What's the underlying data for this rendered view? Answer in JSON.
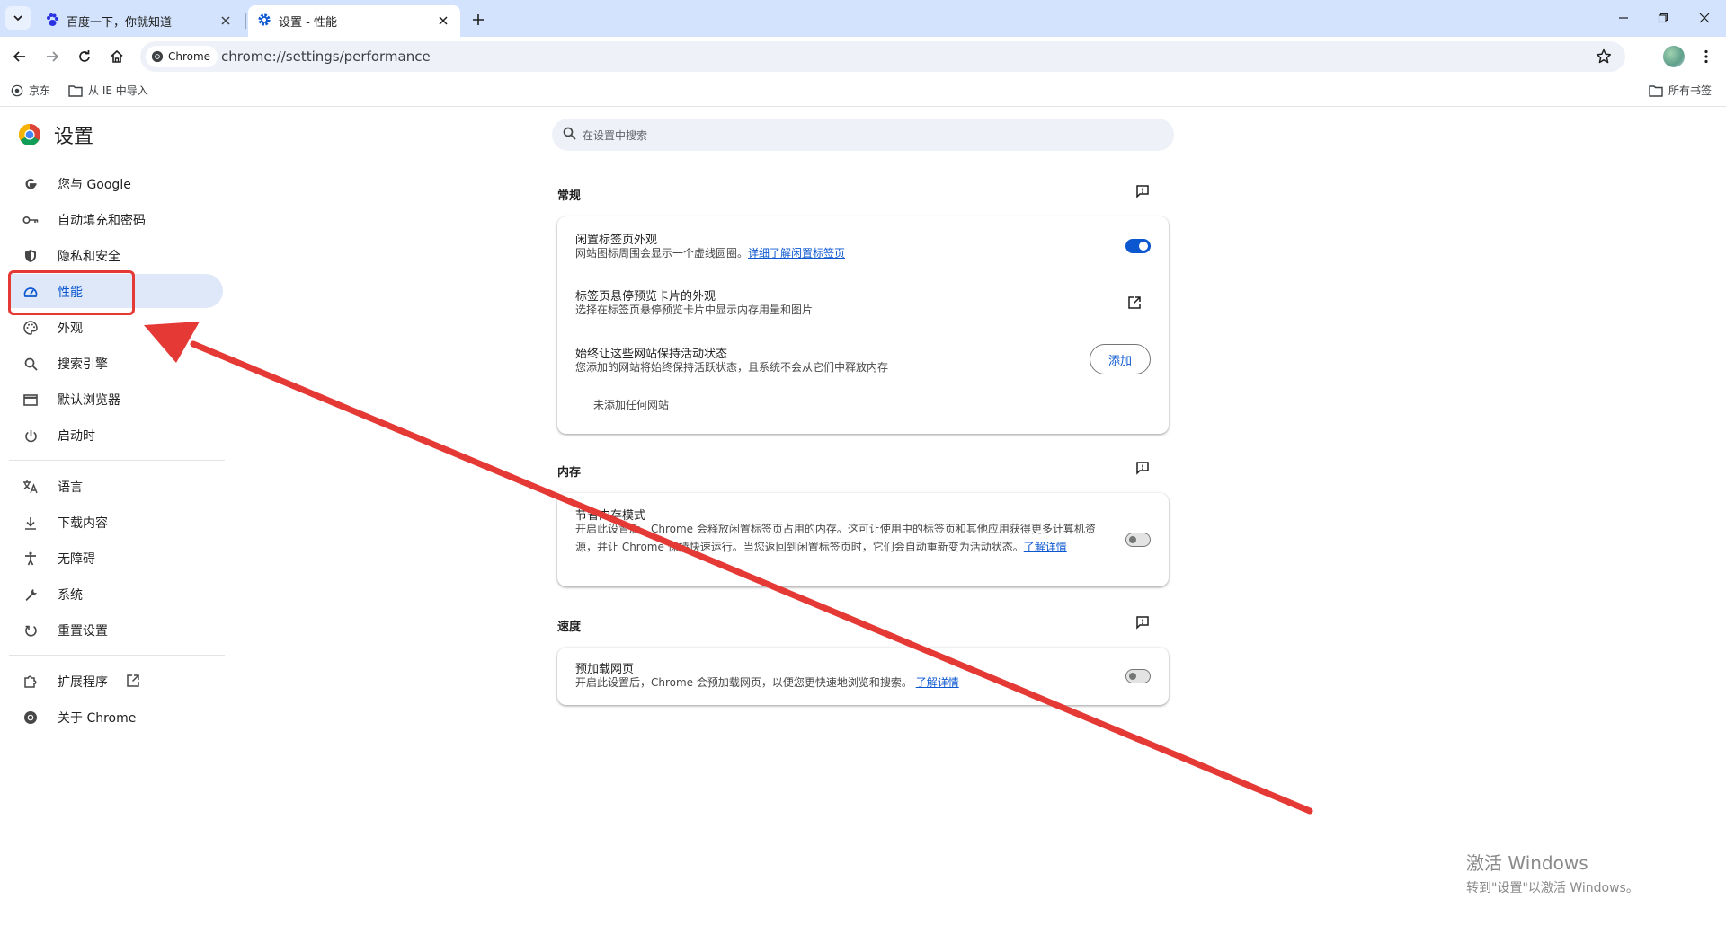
{
  "tabs": [
    {
      "title": "百度一下，你就知道",
      "favicon": "baidu-paw-icon",
      "active": false
    },
    {
      "title": "设置 - 性能",
      "favicon": "gear-icon",
      "active": true
    }
  ],
  "toolbar": {
    "chip_label": "Chrome",
    "url": "chrome://settings/performance"
  },
  "bookmarks": {
    "items": [
      {
        "label": "京东",
        "icon": "globe-icon"
      },
      {
        "label": "从 IE 中导入",
        "icon": "folder-icon"
      }
    ],
    "all_bookmarks": "所有书签"
  },
  "settings": {
    "title": "设置",
    "search_placeholder": "在设置中搜索",
    "nav": [
      {
        "label": "您与 Google",
        "icon": "google-g-icon"
      },
      {
        "label": "自动填充和密码",
        "icon": "key-icon"
      },
      {
        "label": "隐私和安全",
        "icon": "shield-icon"
      },
      {
        "label": "性能",
        "icon": "speedometer-icon",
        "selected": true
      },
      {
        "label": "外观",
        "icon": "palette-icon"
      },
      {
        "label": "搜索引擎",
        "icon": "search-icon"
      },
      {
        "label": "默认浏览器",
        "icon": "browser-window-icon"
      },
      {
        "label": "启动时",
        "icon": "power-icon"
      },
      {
        "label": "语言",
        "icon": "translate-icon"
      },
      {
        "label": "下载内容",
        "icon": "download-icon"
      },
      {
        "label": "无障碍",
        "icon": "accessibility-icon"
      },
      {
        "label": "系统",
        "icon": "wrench-icon"
      },
      {
        "label": "重置设置",
        "icon": "reset-icon"
      },
      {
        "label": "扩展程序",
        "icon": "puzzle-icon"
      },
      {
        "label": "关于 Chrome",
        "icon": "chrome-icon"
      }
    ]
  },
  "sections": {
    "general": {
      "title": "常规",
      "rows": [
        {
          "title": "闲置标签页外观",
          "sub": "网站图标周围会显示一个虚线圆圈。",
          "link": "详细了解闲置标签页",
          "toggle": true
        },
        {
          "title": "标签页悬停预览卡片的外观",
          "sub": "选择在标签页悬停预览卡片中显示内存用量和图片"
        },
        {
          "title": "始终让这些网站保持活动状态",
          "sub": "您添加的网站将始终保持活跃状态，且系统不会从它们中释放内存",
          "button": "添加"
        }
      ],
      "empty_text": "未添加任何网站"
    },
    "memory": {
      "title": "内存",
      "row_title": "节省内存模式",
      "row_sub": "开启此设置后，Chrome 会释放闲置标签页占用的内存。这可让使用中的标签页和其他应用获得更多计算机资源，并让 Chrome 保持快速运行。当您返回到闲置标签页时，它们会自动重新变为活动状态。",
      "link": "了解详情",
      "toggle": false
    },
    "speed": {
      "title": "速度",
      "row_title": "预加载网页",
      "row_sub": "开启此设置后，Chrome 会预加载网页，以便您更快速地浏览和搜索。",
      "link": "了解详情",
      "toggle": false
    }
  },
  "watermark": {
    "line1": "激活 Windows",
    "line2": "转到\"设置\"以激活 Windows。"
  },
  "annotation_color": "#e53935"
}
